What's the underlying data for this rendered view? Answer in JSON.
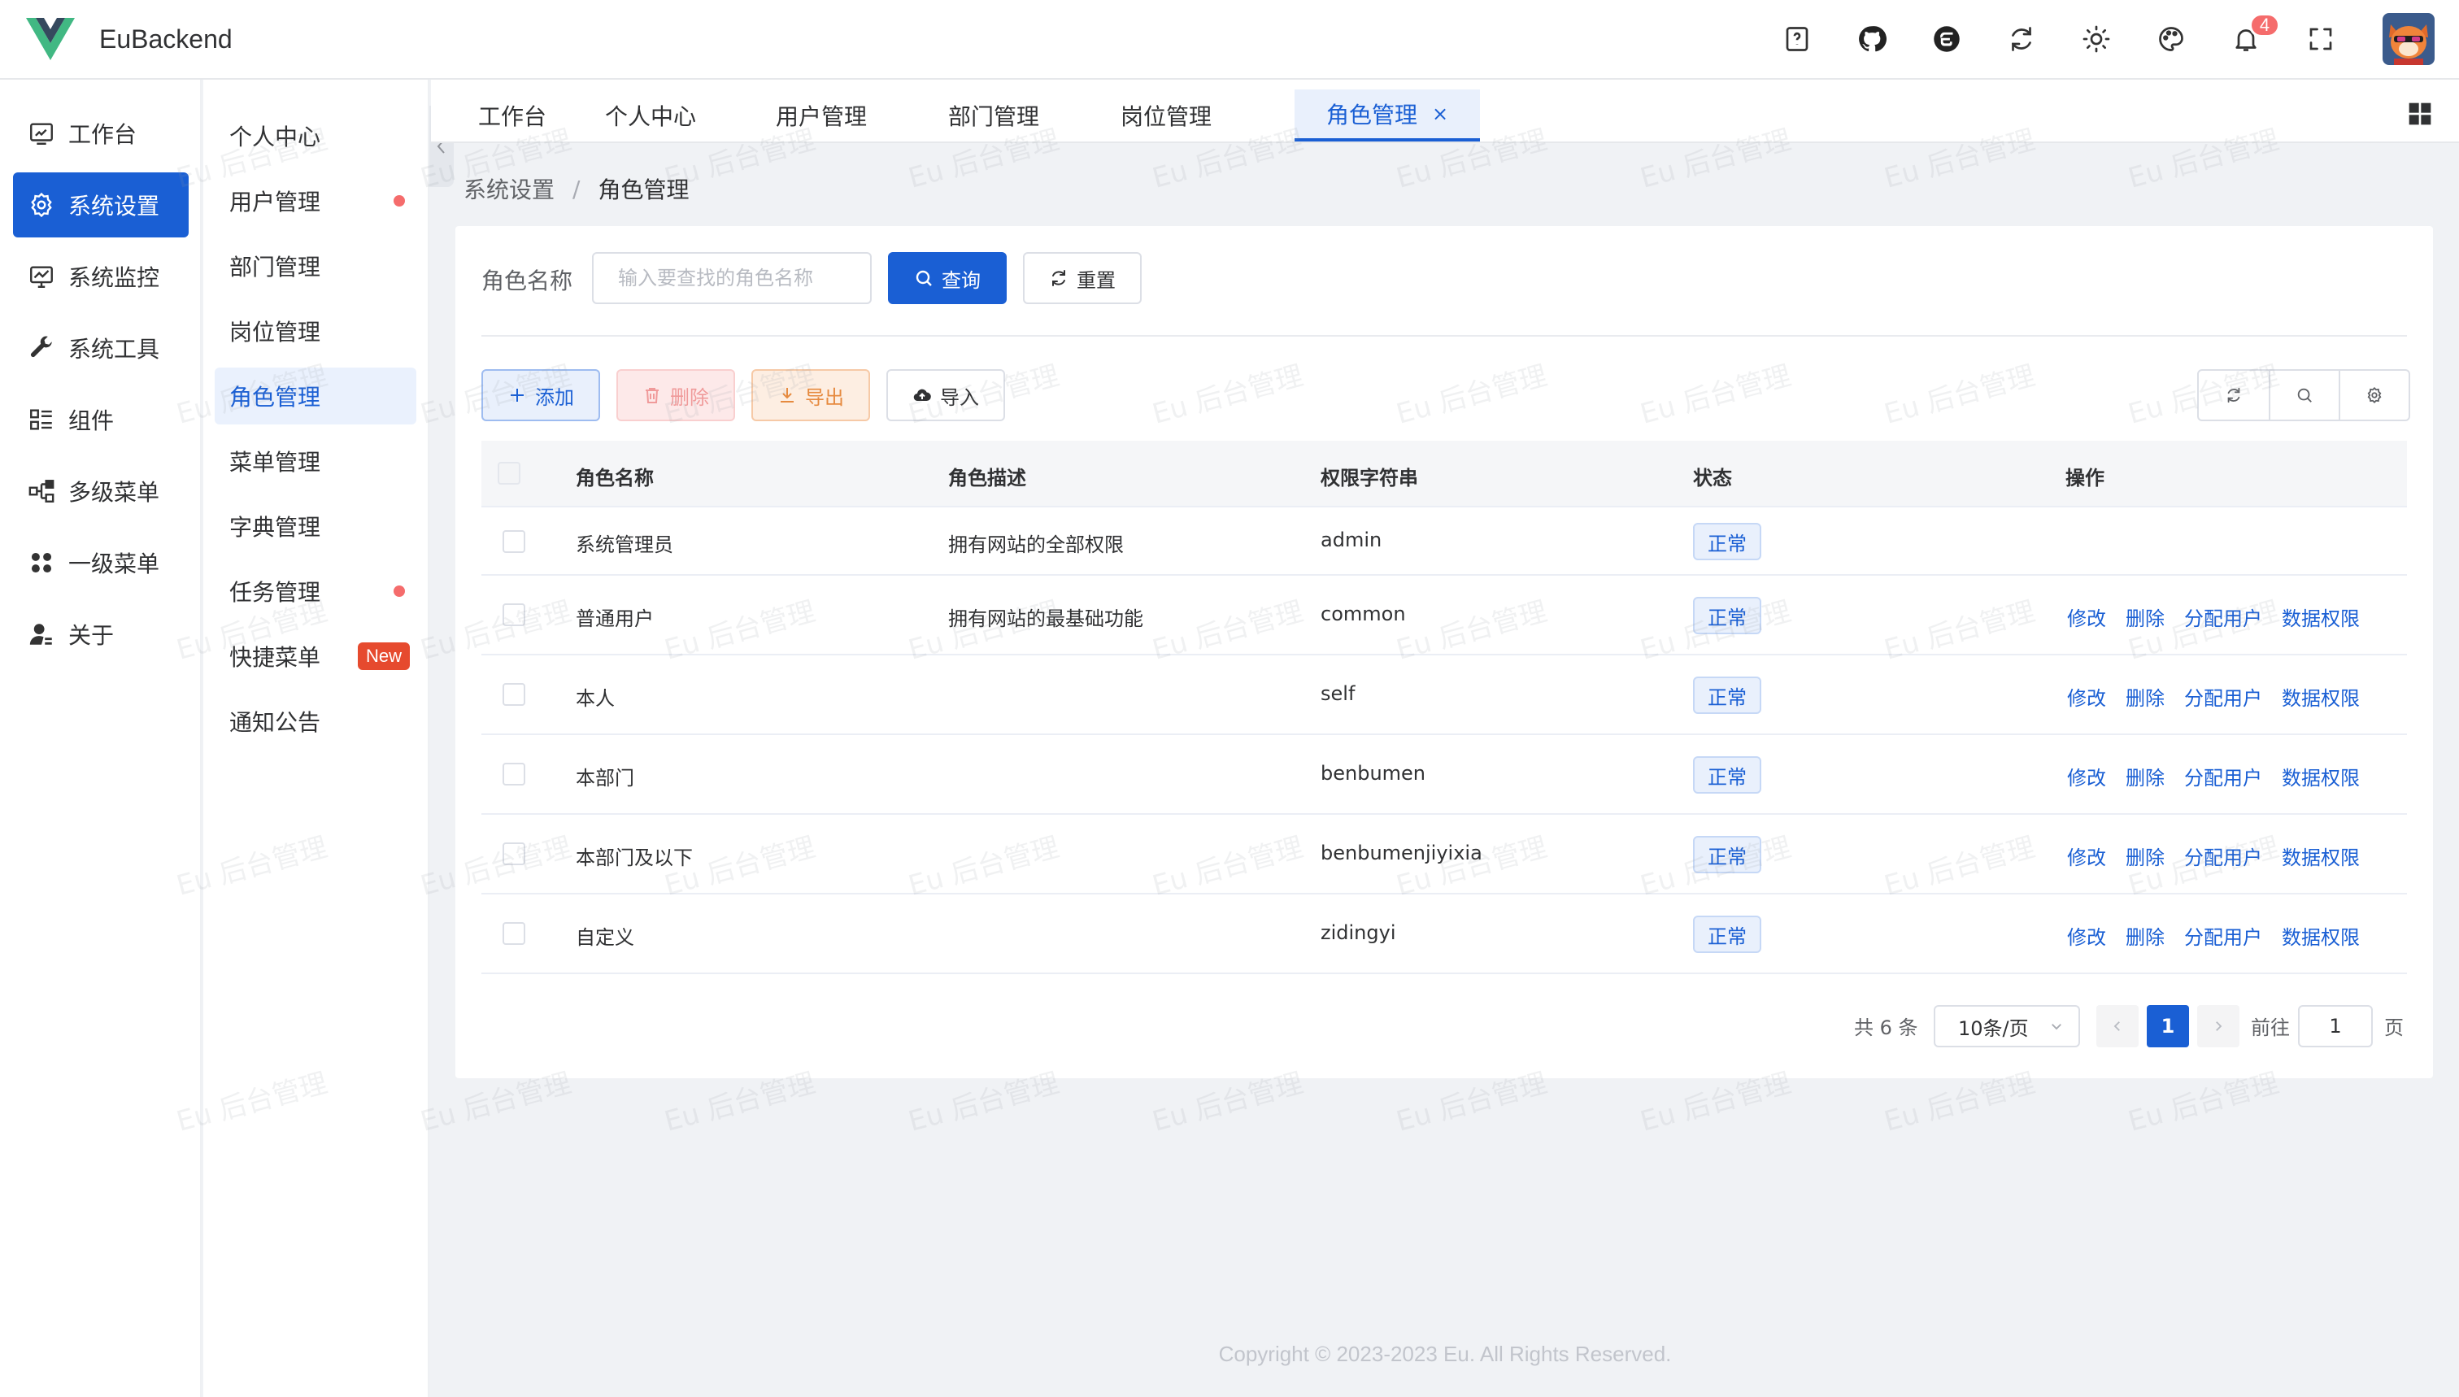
{
  "app": {
    "brand": "EuBackend",
    "notification_count": "4"
  },
  "header_tools": [
    "help-icon",
    "github-icon",
    "gitee-icon",
    "refresh-icon",
    "theme-sun-icon",
    "palette-icon",
    "bell-icon",
    "fullscreen-icon"
  ],
  "sidebar": {
    "items": [
      {
        "label": "工作台",
        "icon": "dashboard-icon"
      },
      {
        "label": "系统设置",
        "icon": "gear-icon",
        "active": true
      },
      {
        "label": "系统监控",
        "icon": "monitor-icon"
      },
      {
        "label": "系统工具",
        "icon": "wrench-icon"
      },
      {
        "label": "组件",
        "icon": "list-icon"
      },
      {
        "label": "多级菜单",
        "icon": "tree-icon"
      },
      {
        "label": "一级菜单",
        "icon": "grid-dots-icon"
      },
      {
        "label": "关于",
        "icon": "user-icon"
      }
    ]
  },
  "submenu": {
    "items": [
      {
        "label": "个人中心"
      },
      {
        "label": "用户管理",
        "dot": true
      },
      {
        "label": "部门管理"
      },
      {
        "label": "岗位管理"
      },
      {
        "label": "角色管理",
        "active": true
      },
      {
        "label": "菜单管理"
      },
      {
        "label": "字典管理"
      },
      {
        "label": "任务管理",
        "dot": true
      },
      {
        "label": "快捷菜单",
        "badge": "New"
      },
      {
        "label": "通知公告"
      }
    ]
  },
  "tabs": [
    {
      "label": "工作台"
    },
    {
      "label": "个人中心"
    },
    {
      "label": "用户管理"
    },
    {
      "label": "部门管理"
    },
    {
      "label": "岗位管理"
    },
    {
      "label": "角色管理",
      "active": true,
      "close": "×"
    }
  ],
  "breadcrumb": {
    "parent": "系统设置",
    "sep": "/",
    "current": "角色管理"
  },
  "search": {
    "label": "角色名称",
    "placeholder": "输入要查找的角色名称",
    "value": "",
    "query_label": "查询",
    "reset_label": "重置"
  },
  "toolbar": {
    "add": "添加",
    "delete": "删除",
    "export": "导出",
    "import": "导入"
  },
  "table": {
    "columns": [
      "角色名称",
      "角色描述",
      "权限字符串",
      "状态",
      "操作"
    ],
    "rows": [
      {
        "name": "系统管理员",
        "desc": "拥有网站的全部权限",
        "key": "admin",
        "status": "正常",
        "ops": []
      },
      {
        "name": "普通用户",
        "desc": "拥有网站的最基础功能",
        "key": "common",
        "status": "正常",
        "ops": [
          "修改",
          "删除",
          "分配用户",
          "数据权限"
        ]
      },
      {
        "name": "本人",
        "desc": "",
        "key": "self",
        "status": "正常",
        "ops": [
          "修改",
          "删除",
          "分配用户",
          "数据权限"
        ]
      },
      {
        "name": "本部门",
        "desc": "",
        "key": "benbumen",
        "status": "正常",
        "ops": [
          "修改",
          "删除",
          "分配用户",
          "数据权限"
        ]
      },
      {
        "name": "本部门及以下",
        "desc": "",
        "key": "benbumenjiyixia",
        "status": "正常",
        "ops": [
          "修改",
          "删除",
          "分配用户",
          "数据权限"
        ]
      },
      {
        "name": "自定义",
        "desc": "",
        "key": "zidingyi",
        "status": "正常",
        "ops": [
          "修改",
          "删除",
          "分配用户",
          "数据权限"
        ]
      }
    ]
  },
  "pagination": {
    "total": "共 6 条",
    "page_size": "10条/页",
    "current": "1",
    "goto_label": "前往",
    "goto_value": "1",
    "page_suffix": "页"
  },
  "footer": {
    "copyright": "Copyright © 2023-2023 Eu. All Rights Reserved."
  },
  "watermark": {
    "text": "Eu 后台管理"
  },
  "colors": {
    "primary": "#1a5fd4",
    "danger": "#f56c6c",
    "warning": "#e68a3f",
    "badge_new": "#e64a2e"
  }
}
